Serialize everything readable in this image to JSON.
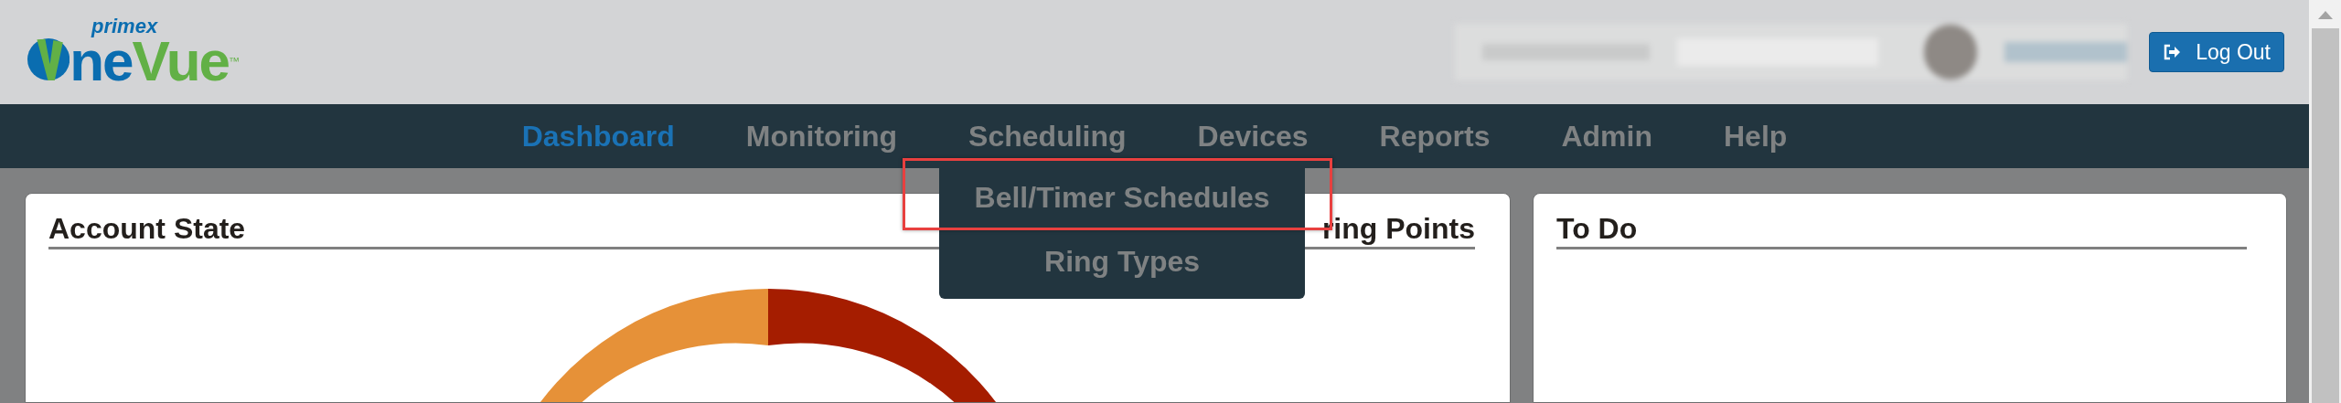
{
  "header": {
    "logo": {
      "brand": "primex",
      "word_start": "ne",
      "word_end": "Vue",
      "trademark": "™"
    },
    "logout_button": {
      "label": "Log Out"
    }
  },
  "nav": {
    "items": [
      {
        "label": "Dashboard",
        "selected": true
      },
      {
        "label": "Monitoring",
        "selected": false
      },
      {
        "label": "Scheduling",
        "selected": false,
        "menu": [
          {
            "label": "Bell/Timer Schedules",
            "highlighted": true
          },
          {
            "label": "Ring Types",
            "highlighted": false
          }
        ]
      },
      {
        "label": "Devices",
        "selected": false
      },
      {
        "label": "Reports",
        "selected": false
      },
      {
        "label": "Admin",
        "selected": false
      },
      {
        "label": "Help",
        "selected": false
      }
    ]
  },
  "panels": [
    {
      "kind": "chart",
      "title": "Account State",
      "title_right": "ring Points"
    },
    {
      "kind": "list",
      "title": "To Do"
    }
  ]
}
